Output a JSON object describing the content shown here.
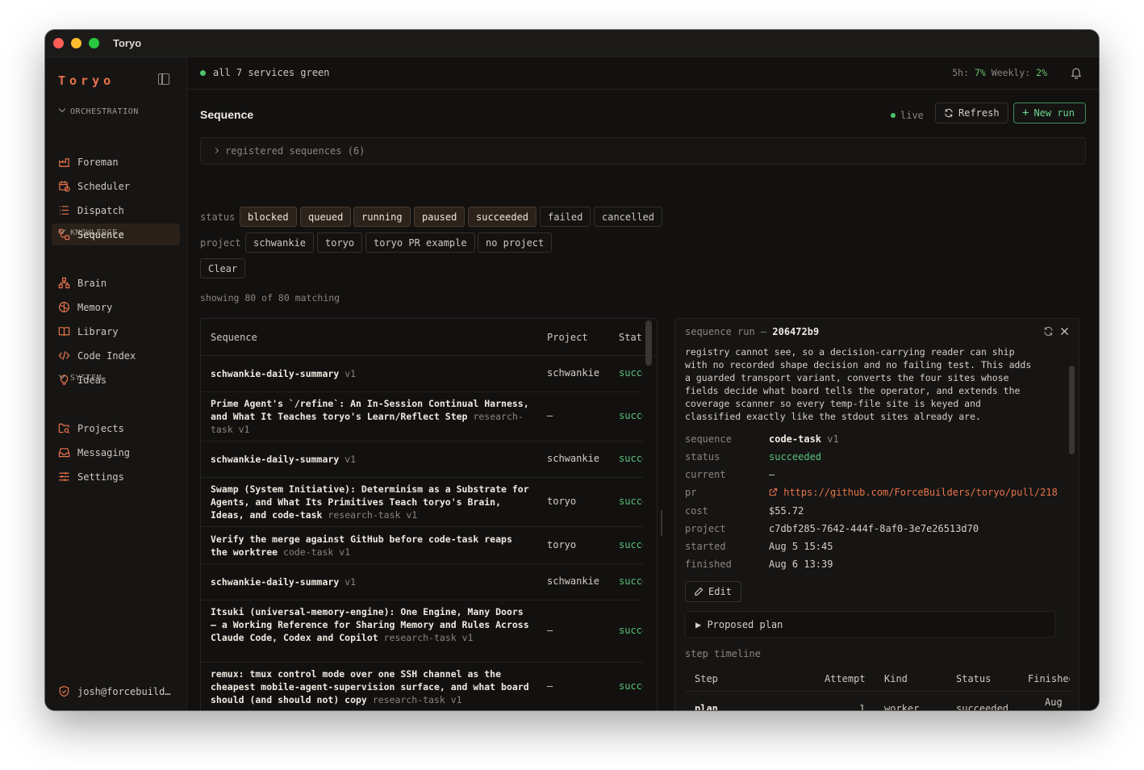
{
  "window": {
    "title": "Toryo"
  },
  "sidebar": {
    "brand": "Toryo",
    "sections": {
      "orchestration": "ORCHESTRATION",
      "knowledge": "KNOWLEDGE",
      "system": "SYSTEM"
    },
    "items": {
      "foreman": "Foreman",
      "scheduler": "Scheduler",
      "dispatch": "Dispatch",
      "sequence": "Sequence",
      "brain": "Brain",
      "memory": "Memory",
      "library": "Library",
      "code_index": "Code Index",
      "ideas": "Ideas",
      "projects": "Projects",
      "messaging": "Messaging",
      "settings": "Settings"
    },
    "active_item": "Sequence",
    "user": "josh@forcebuild…"
  },
  "topbar": {
    "status": "all 7 services green",
    "usage_5h_label": "5h:",
    "usage_5h_value": "7%",
    "usage_weekly_label": "Weekly:",
    "usage_weekly_value": "2%"
  },
  "page": {
    "title": "Sequence",
    "live_label": "live",
    "refresh_label": "Refresh",
    "new_run_label": "New run",
    "registered": "registered sequences (6)",
    "status_filter_label": "status",
    "status_filters": [
      "blocked",
      "queued",
      "running",
      "paused",
      "succeeded",
      "failed",
      "cancelled"
    ],
    "selected_status_filters": [
      "blocked",
      "queued",
      "running",
      "paused",
      "succeeded"
    ],
    "project_filter_label": "project",
    "project_filters": [
      "schwankie",
      "toryo",
      "toryo PR example",
      "no project"
    ],
    "clear_label": "Clear",
    "showing": "showing 80 of 80 matching"
  },
  "table": {
    "headers": {
      "sequence": "Sequence",
      "project": "Project",
      "status": "Status"
    },
    "rows": [
      {
        "name": "schwankie-daily-summary",
        "ver": "v1",
        "project": "schwankie",
        "status": "succeeded"
      },
      {
        "name": "Prime Agent's `/refine`: An In-Session Continual Harness, and What It Teaches toryo's Learn/Reflect Step",
        "ver": "research-task v1",
        "project": "—",
        "status": "succeeded"
      },
      {
        "name": "schwankie-daily-summary",
        "ver": "v1",
        "project": "schwankie",
        "status": "succeeded"
      },
      {
        "name": "Swamp (System Initiative): Determinism as a Substrate for Agents, and What Its Primitives Teach toryo's Brain, Ideas, and code-task",
        "ver": "research-task v1",
        "project": "toryo",
        "status": "succeeded"
      },
      {
        "name": "Verify the merge against GitHub before code-task reaps the worktree",
        "ver": "code-task v1",
        "project": "toryo",
        "status": "succeeded"
      },
      {
        "name": "schwankie-daily-summary",
        "ver": "v1",
        "project": "schwankie",
        "status": "succeeded"
      },
      {
        "name": "Itsuki (universal-memory-engine): One Engine, Many Doors — a Working Reference for Sharing Memory and Rules Across Claude Code, Codex and Copilot",
        "ver": "research-task v1",
        "project": "—",
        "status": "succeeded"
      },
      {
        "name": "remux: tmux control mode over one SSH channel as the cheapest mobile-agent-supervision surface, and what board should (and should not) copy",
        "ver": "research-task v1",
        "project": "—",
        "status": "succeeded"
      }
    ]
  },
  "detail": {
    "header_label": "sequence run —",
    "run_id": "206472b9",
    "description": "registry cannot see, so a decision-carrying reader can ship\nwith no recorded shape decision and no failing test. This adds\na guarded transport variant, converts the four sites whose\nfields decide what board tells the operator, and extends the\ncoverage scanner so every temp-file site is keyed and\nclassified exactly like the stdout sites already are.",
    "fields": {
      "sequence_k": "sequence",
      "sequence_v": "code-task",
      "sequence_ver": "v1",
      "status_k": "status",
      "status_v": "succeeded",
      "current_k": "current",
      "current_v": "—",
      "pr_k": "pr",
      "pr_v": "https://github.com/ForceBuilders/toryo/pull/218",
      "cost_k": "cost",
      "cost_v": "$55.72",
      "project_k": "project",
      "project_v": "c7dbf285-7642-444f-8af0-3e7e26513d70",
      "started_k": "started",
      "started_v": "Aug 5 15:45",
      "finished_k": "finished",
      "finished_v": "Aug 6 13:39"
    },
    "edit_label": "Edit",
    "proposed_plan": "▶ Proposed plan",
    "timeline_label": "step timeline",
    "timeline_headers": {
      "step": "Step",
      "attempt": "Attempt",
      "kind": "Kind",
      "status": "Status",
      "finished": "Finished"
    },
    "timeline_row": {
      "step": "plan",
      "attempt": "1",
      "kind": "worker",
      "status": "succeeded",
      "finished": "Aug"
    }
  },
  "colors": {
    "accent": "#e8734a",
    "success": "#58c27a",
    "live": "#4cc26b"
  }
}
